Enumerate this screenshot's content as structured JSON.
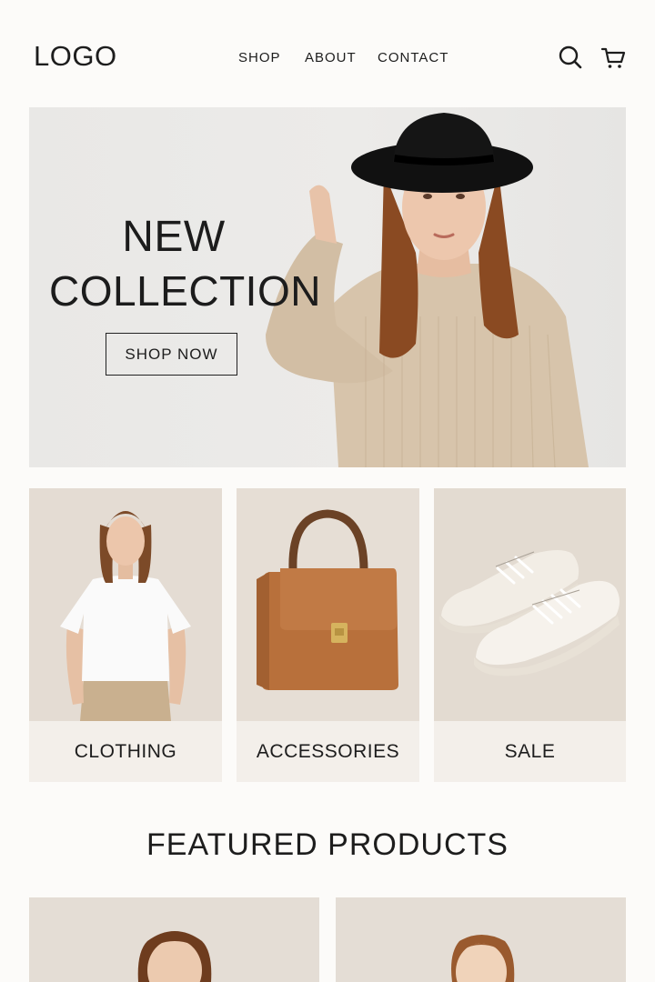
{
  "header": {
    "logo": "LOGO",
    "nav": [
      "SHOP",
      "ABOUT",
      "CONTACT"
    ],
    "icons": [
      "search-icon",
      "cart-icon"
    ]
  },
  "hero": {
    "title_line1": "NEW",
    "title_line2": "COLLECTION",
    "cta": "SHOP NOW"
  },
  "categories": [
    {
      "label": "CLOTHING",
      "image": "woman in white t-shirt"
    },
    {
      "label": "ACCESSORIES",
      "image": "brown leather handbag"
    },
    {
      "label": "SALE",
      "image": "white sneakers"
    }
  ],
  "featured": {
    "title": "FEATURED PRODUCTS"
  },
  "colors": {
    "background": "#fcfbf9",
    "text": "#1d1d1d",
    "card": "#e4dcd3",
    "label_band": "#f3efea"
  }
}
